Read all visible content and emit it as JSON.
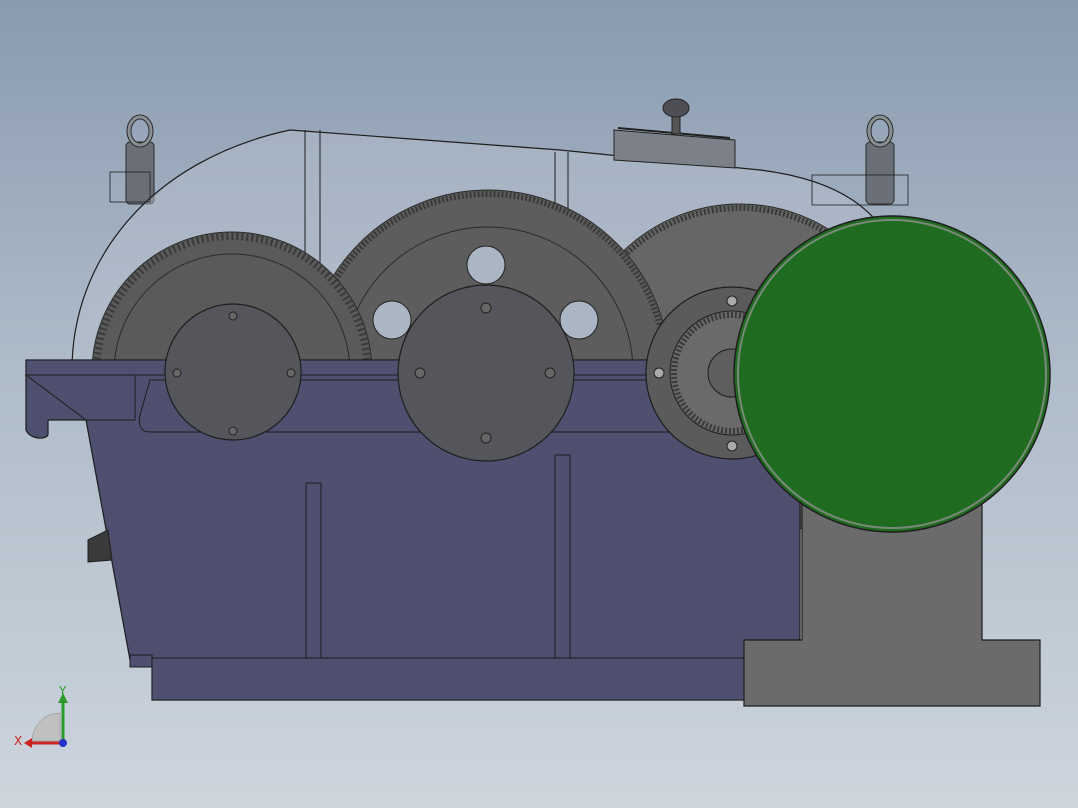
{
  "viewport": {
    "background_top": "#8a9bb0",
    "background_bottom": "#cdd5dd"
  },
  "model": {
    "housing_color": "#4f4f6f",
    "cover_color": "#aab6c4",
    "gear_color": "#5a5a5a",
    "motor_color": "#1f6b1f",
    "pedestal_color": "#666666"
  },
  "triad": {
    "x_label": "X",
    "y_label": "Y",
    "x_color": "#cc2222",
    "y_color": "#22aa22",
    "z_color": "#2233cc"
  }
}
